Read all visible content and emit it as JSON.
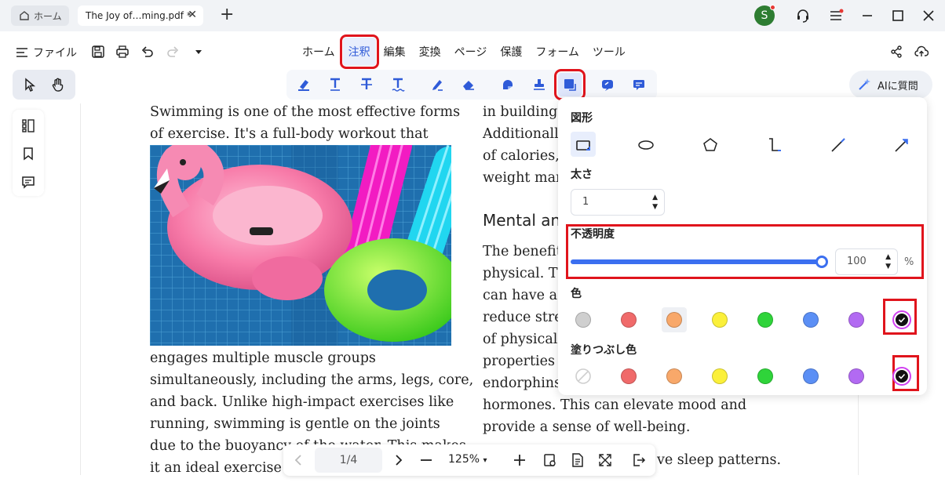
{
  "titlebar": {
    "home_tab": "ホーム",
    "doc_tab": "The Joy of…ming.pdf *",
    "close_glyph": "✕",
    "new_tab_glyph": "+",
    "user_initial": "S"
  },
  "menubar": {
    "file": "ファイル",
    "items": [
      "ホーム",
      "注釈",
      "編集",
      "変換",
      "ページ",
      "保護",
      "フォーム",
      "ツール"
    ],
    "active": "注釈"
  },
  "ai_button": "AIに質問",
  "document": {
    "left_column": [
      "Swimming is one of the most effective forms",
      "of exercise. It's a full-body workout that",
      "engages multiple muscle groups",
      "simultaneously, including the arms, legs, core,",
      "and back. Unlike high-impact exercises like",
      "running, swimming is gentle on the joints",
      "due to the buoyancy of the water. This makes",
      "it an ideal exercise fo"
    ],
    "right_column_top": [
      "in building",
      "Additionall",
      "of calories,",
      "weight mar"
    ],
    "heading": "Mental an",
    "right_column_bottom": [
      "The benefit",
      "physical. Th",
      "can have a",
      "reduce stre",
      "of physical",
      "properties",
      "endorphins",
      "hormones. This can elevate mood and",
      "provide a sense of well-being."
    ],
    "trailing_text": "ve sleep patterns."
  },
  "bottom_nav": {
    "page": "1/4",
    "zoom": "125%",
    "zoom_caret": "▾"
  },
  "popover": {
    "shape_label": "図形",
    "thickness_label": "太さ",
    "thickness_value": "1",
    "opacity_label": "不透明度",
    "opacity_value": "100",
    "opacity_unit": "%",
    "opacity_level": 1.0,
    "color_label": "色",
    "fill_label": "塗りつぶし色",
    "colors": [
      "#cfcfcf",
      "#f06a6a",
      "#f8a86a",
      "#fbf03a",
      "#2fd43a",
      "#5b8ff5",
      "#b26af2",
      "#111111"
    ],
    "fill_colors": [
      "none",
      "#f06a6a",
      "#f8a86a",
      "#fbf03a",
      "#2fd43a",
      "#5b8ff5",
      "#b26af2",
      "#111111"
    ],
    "selected_color": "#111111",
    "selected_fill": "#111111",
    "shapes": [
      "rectangle-icon",
      "ellipse-icon",
      "polygon-icon",
      "connector-icon",
      "line-icon",
      "arrow-icon"
    ]
  },
  "accent_color": "#3b6ff0",
  "highlight_color": "#e0141c"
}
